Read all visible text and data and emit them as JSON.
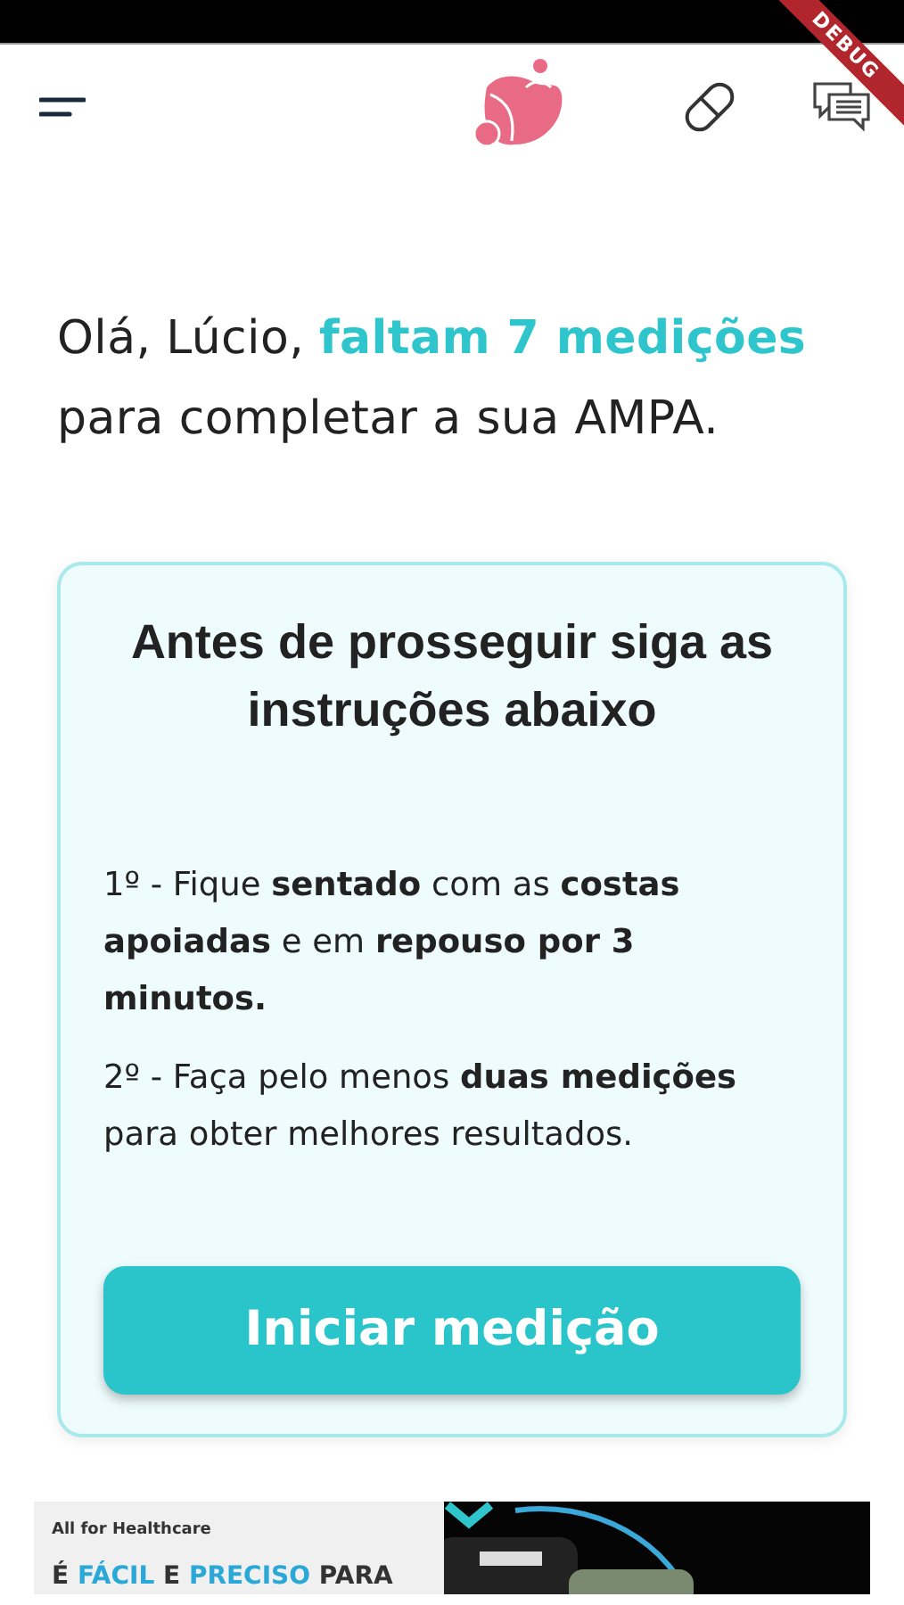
{
  "debug_ribbon": "DEBUG",
  "greeting": {
    "text": "Olá, Lúcio, ",
    "highlight": "faltam 7 medições",
    "rest": "para completar a sua AMPA."
  },
  "card": {
    "title": "Antes de prosseguir siga as instruções abaixo",
    "instructions": [
      "1º - Fique **sentado** com as **costas apoiadas** e em **repouso por 3 minutos.**",
      "2º - Faça pelo menos **duas medições** para obter melhores resultados."
    ],
    "button": "Iniciar medição"
  },
  "banner": {
    "tagline": "All for Healthcare",
    "headline": [
      {
        "text": "É ",
        "highlight": false
      },
      {
        "text": "FÁCIL",
        "highlight": true
      },
      {
        "text": " E ",
        "highlight": false
      },
      {
        "text": "PRECISO",
        "highlight": true
      },
      {
        "text": " PARA",
        "highlight": false
      }
    ]
  }
}
